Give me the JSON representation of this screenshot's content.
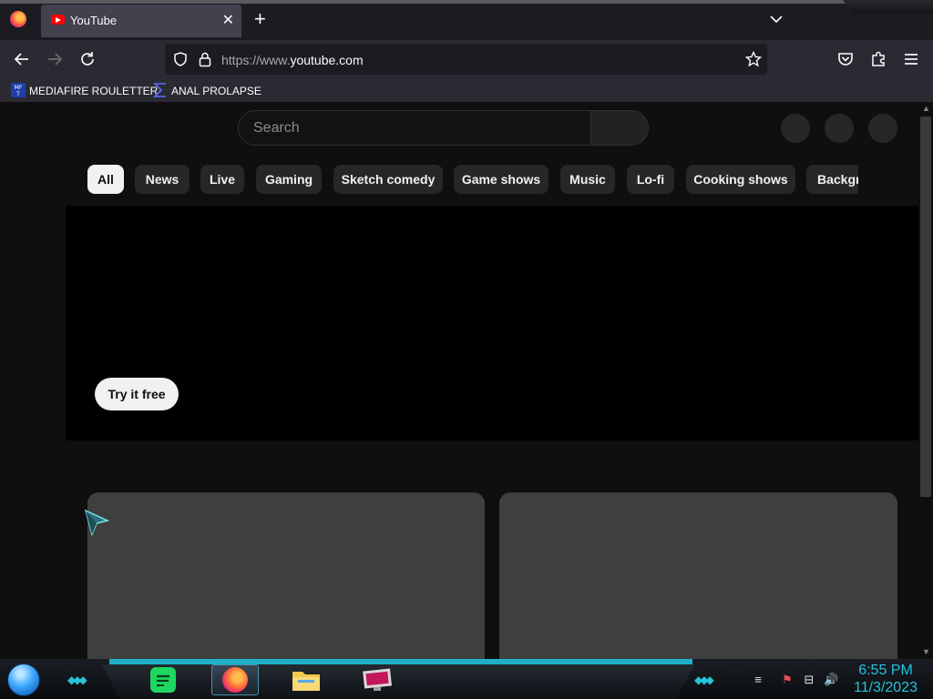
{
  "browser": {
    "tab": {
      "title": "YouTube"
    },
    "url": {
      "prefix": "https://www.",
      "domain": "youtube.com"
    },
    "bookmarks": [
      {
        "label": "MEDIAFIRE ROULETTER",
        "icon": "mediafire-icon"
      },
      {
        "label": "ANAL PROLAPSE",
        "icon": "bookmark-sigma-icon"
      }
    ]
  },
  "youtube": {
    "search": {
      "placeholder": "Search"
    },
    "chips": [
      "All",
      "News",
      "Live",
      "Gaming",
      "Sketch comedy",
      "Game shows",
      "Music",
      "Lo-fi",
      "Cooking shows",
      "Background music"
    ],
    "banner": {
      "cta": "Try it free"
    }
  },
  "taskbar": {
    "apps": [
      "spotify",
      "firefox",
      "file-explorer",
      "display-app"
    ],
    "clock": {
      "time": "6:55 PM",
      "date": "11/3/2023"
    }
  },
  "colors": {
    "page_bg": "#0f0f0f",
    "chip_bg": "#272727",
    "chip_active_bg": "#f1f1f1",
    "accent_cyan": "#27c3d8",
    "browser_toolbar": "#2b2a33"
  }
}
